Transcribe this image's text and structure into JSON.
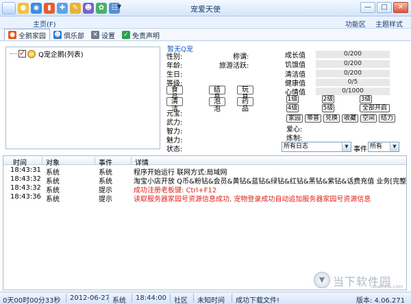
{
  "window": {
    "title": "宠爱天使",
    "controls": [
      "—",
      "□",
      "✕"
    ]
  },
  "menubar": {
    "home": "主页(F)",
    "right": [
      "功能区",
      "主题样式"
    ]
  },
  "tabs": [
    {
      "label": "全鹅家园",
      "icon": "penguin-icon",
      "active": true
    },
    {
      "label": "俱乐部",
      "icon": "club-icon"
    },
    {
      "label": "设置",
      "icon": "wrench-icon"
    },
    {
      "label": "免责声明",
      "icon": "disclaimer-icon"
    }
  ],
  "tree": {
    "root": "Q宠企鹅(列表)"
  },
  "pet_info": {
    "name": "暂无Q宠",
    "gender": "性别:",
    "title": "称谓:",
    "age": "年龄:",
    "activity": "旅游活跃:",
    "birthday": "生日:",
    "level": "等级:",
    "buttons_row1": [
      "食品",
      "结晶",
      "玩具"
    ],
    "buttons_row2": [
      "清洁",
      "泡泡",
      "药品"
    ],
    "yuanbao": "元宝:",
    "force": "武力:",
    "intellect": "智力:",
    "charm": "魅力:",
    "status": "状态:"
  },
  "stats": {
    "rows": [
      {
        "label": "成长值",
        "value": "0/200"
      },
      {
        "label": "饥饿值",
        "value": "0/200"
      },
      {
        "label": "清洁值",
        "value": "0/200"
      },
      {
        "label": "健康值",
        "value": "0/5"
      },
      {
        "label": "心情值",
        "value": "0/1000"
      }
    ],
    "levels_row1": [
      "1级",
      "2级",
      "3级"
    ],
    "levels_row2": [
      "4级",
      "5级",
      "全部开启"
    ],
    "actions": [
      "家园",
      "带普",
      "兑换",
      "收藏",
      "空间",
      "结力"
    ],
    "love": "爱心:",
    "work": "炼制:"
  },
  "filters": {
    "log_type": "所有日志",
    "event_label": "事件",
    "event_value": "所有"
  },
  "log": {
    "headers": [
      "时间",
      "对象",
      "事件",
      "详情"
    ],
    "rows": [
      {
        "time": "18:43:31",
        "object": "系统",
        "event": "系统",
        "detail": "程序开始运行 联网方式:局域网",
        "red": false
      },
      {
        "time": "18:43:32",
        "object": "系统",
        "event": "系统",
        "detail": "淘宝小店开放 Q币&粉钻&会员&黄钻&蓝钻&绿钻&红钻&黑钻&紫钻&话费充值 业务[完整包:http://",
        "red": false
      },
      {
        "time": "18:43:32",
        "object": "系统",
        "event": "提示",
        "detail": "成功注册老板键: Ctrl+F12",
        "red": true
      },
      {
        "time": "18:43:36",
        "object": "系统",
        "event": "提示",
        "detail": "读取服务器家园号资源信息成功, 宠物登录成功自动追加服务器家园号资源信息",
        "red": true
      }
    ]
  },
  "watermark": {
    "text": "当下软件园",
    "domain": "downxia.com"
  },
  "statusbar": {
    "uptime": "0天00时00分33秒",
    "date": "2012-06-27",
    "system": "系统",
    "time": "18:44:00",
    "community": "社区",
    "unknown_time": "未知时间",
    "message": "成功下载文件!",
    "version": "版本: 4.06.271"
  },
  "colors": {
    "accent": "#1459c7",
    "warning": "#e0201a"
  }
}
